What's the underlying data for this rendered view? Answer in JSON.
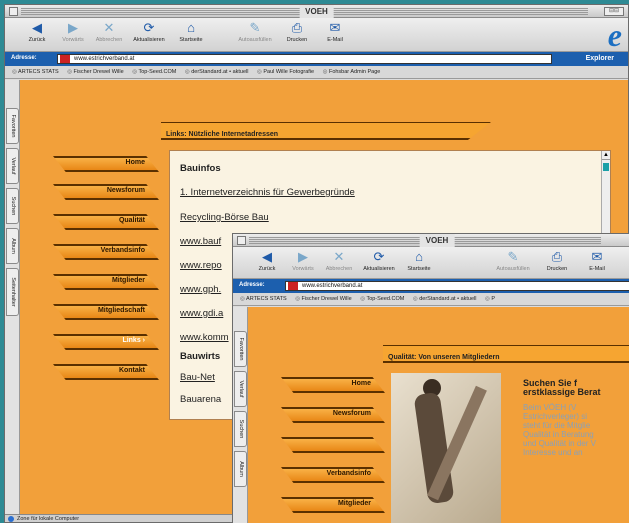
{
  "main_window": {
    "title": "VOEH",
    "toolbar": [
      {
        "label": "Zurück",
        "icon": "◀",
        "disabled": false
      },
      {
        "label": "Vorwärts",
        "icon": "▶",
        "disabled": true
      },
      {
        "label": "Abbrechen",
        "icon": "✕",
        "disabled": true
      },
      {
        "label": "Aktualisieren",
        "icon": "⟳",
        "disabled": false
      },
      {
        "label": "Startseite",
        "icon": "⌂",
        "disabled": false
      },
      {
        "label": "Autoausfüllen",
        "icon": "✎",
        "disabled": true
      },
      {
        "label": "Drucken",
        "icon": "⎙",
        "disabled": false
      },
      {
        "label": "E-Mail",
        "icon": "✉",
        "disabled": false
      }
    ],
    "address_label": "Adresse:",
    "address": "www.estrichverband.at",
    "go_label": "Explorer",
    "favorites": [
      "ARTECS STATS",
      "Fischer Drewel Wille",
      "Top-Seed.COM",
      "derStandard.at • aktuell",
      "Paul Wille Fotografie",
      "Fohsbar Admin Page"
    ],
    "side_tabs": [
      "Favoriten",
      "Verlauf",
      "Suchen",
      "Album",
      "Seitenhalter"
    ],
    "header": "Links: Nützliche Internetadressen",
    "nav": [
      "Home",
      "Newsforum",
      "Qualität",
      "Verbandsinfo",
      "Mitglieder",
      "Mitgliedschaft",
      "Links ›",
      "Kontakt"
    ],
    "links": [
      {
        "text": "Bauinfos",
        "style": "heading"
      },
      {
        "text": "1. Internetverzeichnis für Gewerbegründe",
        "style": "link"
      },
      {
        "text": "Recycling-Börse Bau",
        "style": "link"
      },
      {
        "text": "www.bauf",
        "style": "link"
      },
      {
        "text": "www.repo",
        "style": "link"
      },
      {
        "text": "www.gph.",
        "style": "link"
      },
      {
        "text": "www.gdi.a",
        "style": "link"
      },
      {
        "text": "www.komm",
        "style": "link"
      },
      {
        "text": "Bauwirts",
        "style": "heading"
      },
      {
        "text": "Bau-Net",
        "style": "link"
      },
      {
        "text": "Bauarena",
        "style": "plain"
      }
    ],
    "status": "Zone für lokale Computer"
  },
  "second_window": {
    "title": "VOEH",
    "address": "www.estrichverband.at",
    "favorites": [
      "ARTECS STATS",
      "Fischer Drewel Wille",
      "Top-Seed.COM",
      "derStandard.at • aktuell",
      "P"
    ],
    "header": "Qualität: Von unseren Mitgliedern",
    "nav": [
      "Home",
      "Newsforum",
      "",
      "Verbandsinfo",
      "Mitglieder"
    ],
    "text_heading_1": "Suchen   Sie   f",
    "text_heading_2": "erstklassige Berat",
    "text_body": [
      "Beim   VÖEH   (V",
      "Estrichverleger) si",
      "steht für die Mitglie",
      "Qualität in Beratung",
      "und Qualität in der V",
      "",
      "Interesse   und   an"
    ]
  },
  "colors": {
    "accent_orange": "#f2a03a",
    "brand_blue": "#1c5fae",
    "background_teal": "#2e8a94"
  }
}
